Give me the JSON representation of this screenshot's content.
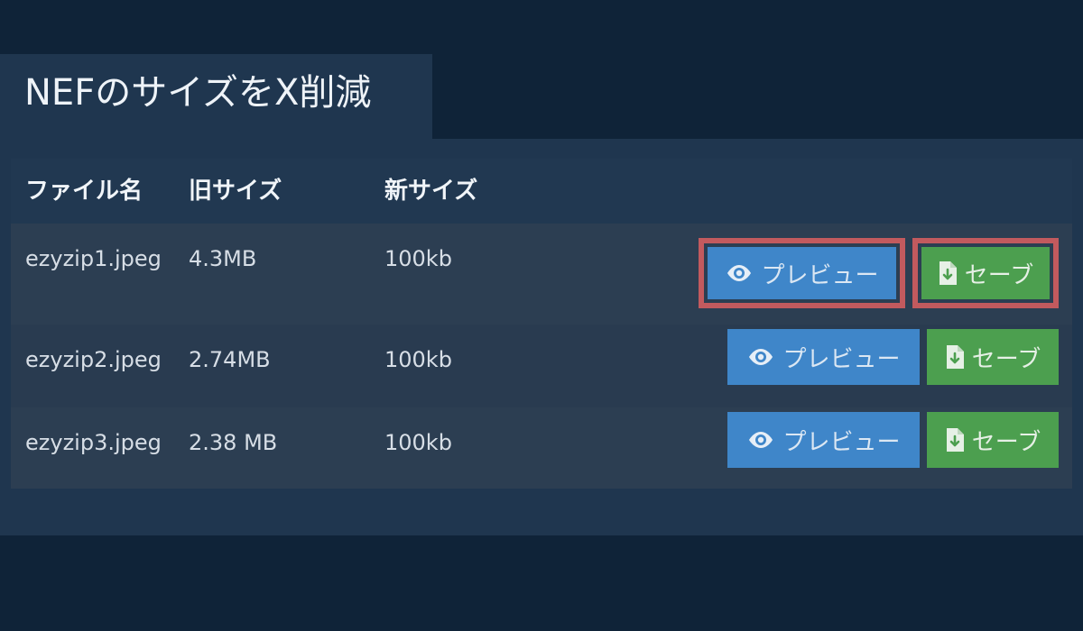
{
  "page": {
    "title": "NEFのサイズをX削減"
  },
  "table": {
    "headers": {
      "filename": "ファイル名",
      "old_size": "旧サイズ",
      "new_size": "新サイズ"
    },
    "rows": [
      {
        "filename": "ezyzip1.jpeg",
        "old_size": "4.3MB",
        "new_size": "100kb",
        "preview_label": "プレビュー",
        "save_label": "セーブ"
      },
      {
        "filename": "ezyzip2.jpeg",
        "old_size": "2.74MB",
        "new_size": "100kb",
        "preview_label": "プレビュー",
        "save_label": "セーブ"
      },
      {
        "filename": "ezyzip3.jpeg",
        "old_size": "2.38 MB",
        "new_size": "100kb",
        "preview_label": "プレビュー",
        "save_label": "セーブ"
      }
    ]
  },
  "icons": {
    "preview": "eye-icon",
    "save": "file-download-icon"
  },
  "colors": {
    "background": "#0f2338",
    "panel": "#1f364f",
    "preview_button": "#3f86c9",
    "save_button": "#4c9f4f",
    "highlight": "#c25a5e"
  }
}
